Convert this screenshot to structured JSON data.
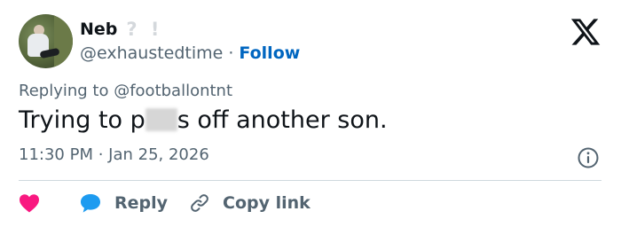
{
  "author": {
    "display_name": "Neb",
    "name_extra": "? !",
    "handle": "@exhaustedtime",
    "separator": "·",
    "follow_label": "Follow"
  },
  "tweet": {
    "replying_to": "Replying to @footballontnt",
    "text_before": "Trying to p",
    "text_after": "s off another son.",
    "timestamp": "11:30 PM · Jan 25, 2026"
  },
  "actions": {
    "like_icon": "heart-icon",
    "reply_label": "Reply",
    "copy_link_label": "Copy link"
  },
  "colors": {
    "text": "#0f1419",
    "secondary": "#536471",
    "link": "#0066c0",
    "like": "#f91880",
    "reply": "#1d9bf0",
    "divider": "#cfd9de"
  }
}
